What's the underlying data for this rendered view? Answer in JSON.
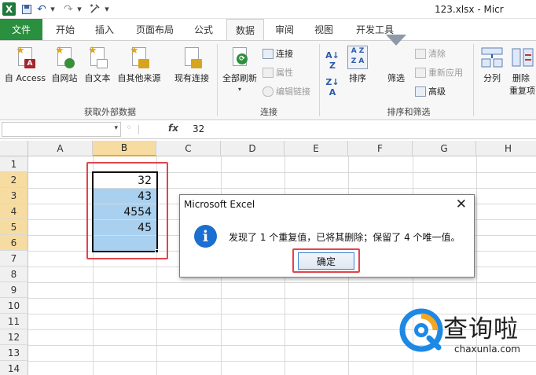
{
  "app": {
    "logo_letter": "X",
    "title": "123.xlsx - Micr"
  },
  "qat": {
    "undo": "↶",
    "redo": "↷",
    "more": "▾"
  },
  "tabs": [
    "文件",
    "开始",
    "插入",
    "页面布局",
    "公式",
    "数据",
    "审阅",
    "视图",
    "开发工具"
  ],
  "active_tab": "数据",
  "ribbon": {
    "get_external": {
      "label": "获取外部数据",
      "buttons": [
        "自 Access",
        "自网站",
        "自文本",
        "自其他来源",
        "现有连接"
      ]
    },
    "connections": {
      "label": "连接",
      "refresh_all": "全部刷新",
      "connections": "连接",
      "properties": "属性",
      "edit_links": "编辑链接"
    },
    "sort_filter": {
      "label": "排序和筛选",
      "sort": "排序",
      "filter": "筛选",
      "clear": "清除",
      "reapply": "重新应用",
      "advanced": "高级"
    },
    "data_tools": {
      "text_to_columns": "分列",
      "remove_dup_1": "删除",
      "remove_dup_2": "重复项"
    }
  },
  "formula_bar": {
    "fx": "fx",
    "value": "32"
  },
  "sheet": {
    "columns": [
      "A",
      "B",
      "C",
      "D",
      "E",
      "F",
      "G",
      "H"
    ],
    "rows": [
      "1",
      "2",
      "3",
      "4",
      "5",
      "6",
      "7",
      "8",
      "9",
      "10",
      "11",
      "12",
      "13",
      "14"
    ],
    "selected_column": "B",
    "cells": {
      "B2": "32",
      "B3": "43",
      "B4": "4554",
      "B5": "45"
    }
  },
  "dialog": {
    "title": "Microsoft Excel",
    "close": "✕",
    "info_glyph": "i",
    "message": "发现了 1 个重复值，已将其删除；保留了 4 个唯一值。",
    "ok": "确定"
  },
  "watermark": {
    "text": "查询啦",
    "url": "chaxunla.com"
  },
  "colors": {
    "file_tab": "#2a8f3e",
    "selection_fill": "#a9d0ef",
    "highlight_box": "#e0454a",
    "selected_header": "#f6dca1",
    "info_icon": "#1b6fd0"
  }
}
